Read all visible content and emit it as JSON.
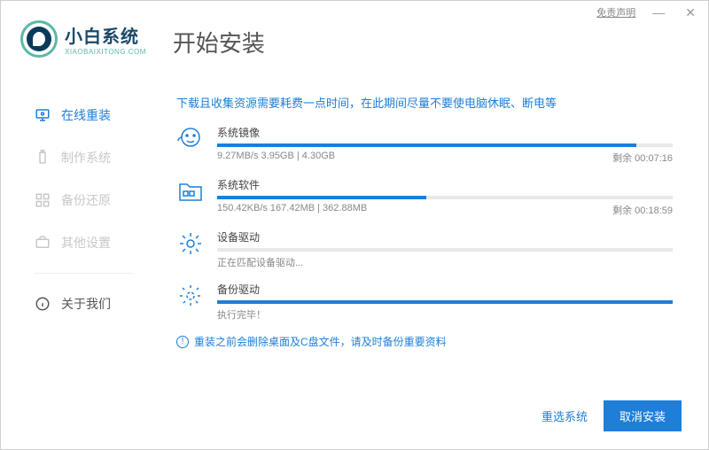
{
  "titlebar": {
    "disclaimer": "免责声明"
  },
  "logo": {
    "cn": "小白系统",
    "en": "XIAOBAIXITONG.COM"
  },
  "page_title": "开始安装",
  "sidebar": {
    "items": [
      {
        "label": "在线重装"
      },
      {
        "label": "制作系统"
      },
      {
        "label": "备份还原"
      },
      {
        "label": "其他设置"
      },
      {
        "label": "关于我们"
      }
    ]
  },
  "notice": "下载且收集资源需要耗费一点时间，在此期间尽量不要使电脑休眠、断电等",
  "tasks": [
    {
      "title": "系统镜像",
      "left_text": "9.27MB/s 3.95GB | 4.30GB",
      "right_text": "剩余 00:07:16",
      "progress": 92
    },
    {
      "title": "系统软件",
      "left_text": "150.42KB/s 167.42MB | 362.88MB",
      "right_text": "剩余 00:18:59",
      "progress": 46
    },
    {
      "title": "设备驱动",
      "status": "正在匹配设备驱动...",
      "progress": 0
    },
    {
      "title": "备份驱动",
      "status": "执行完毕！",
      "progress": 100
    }
  ],
  "warning": "重装之前会删除桌面及C盘文件，请及时备份重要资料",
  "footer": {
    "reselect": "重选系统",
    "cancel": "取消安装"
  }
}
